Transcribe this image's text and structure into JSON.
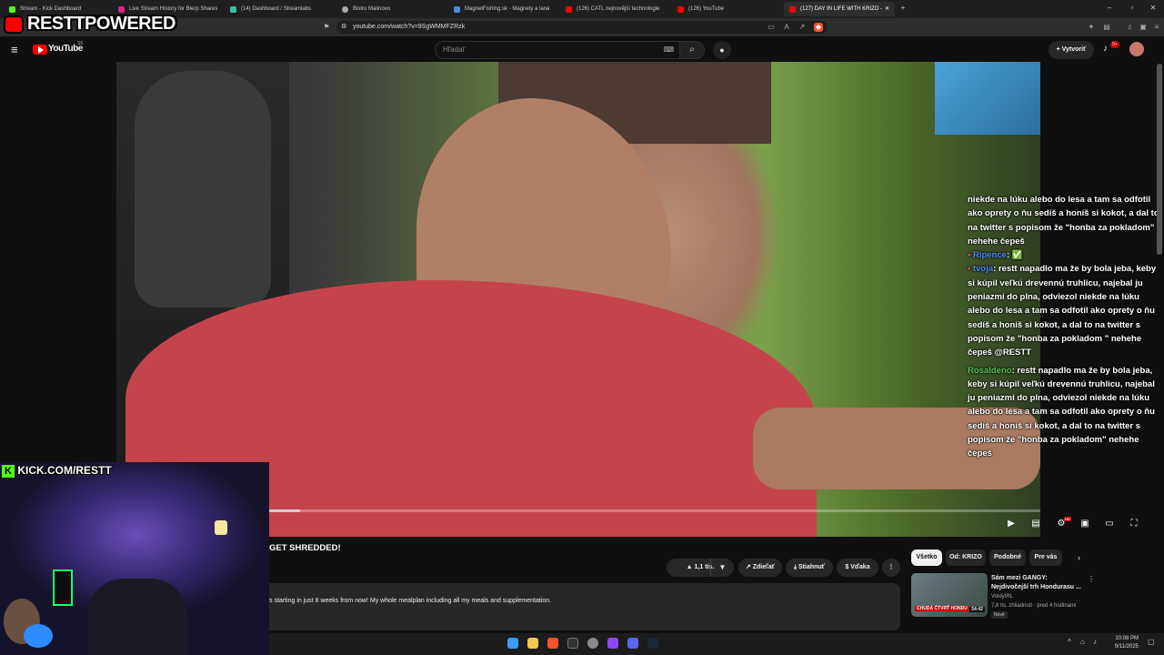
{
  "browser": {
    "tabs": [
      {
        "label": "Stream - Kick Dashboard",
        "color": "#53fc18"
      },
      {
        "label": "Live Stream History for Blerp Shares",
        "color": "#e0218a"
      },
      {
        "label": "(14) Dashboard / Streamlabs",
        "color": "#31c3a2"
      },
      {
        "label": "Bistro Malinovo",
        "color": "#aaaaaa"
      },
      {
        "label": "MagnetFishing.sk - Magnety a laná",
        "color": "#4a90d9"
      },
      {
        "label": "(126) CATL nejnovější technologie",
        "color": "#ff0000"
      },
      {
        "label": "(126) YouTube",
        "color": "#ff0000"
      },
      {
        "label": "(127) DAY IN LIFE WITH KRIZO -",
        "color": "#ff0000"
      }
    ],
    "url": "youtube.com/watch?v=9SgWMMFZRzk"
  },
  "youtube": {
    "logo_text": "YouTube",
    "country": "SK",
    "search_placeholder": "Hľadať",
    "create_label": "Vytvoriť",
    "notif_count": "9+",
    "video_title": "GET SHREDDED!",
    "like_label": "1,1 tis.",
    "share_label": "Zdieľať",
    "download_label": "Stiahnuť",
    "thanks_label": "Vďaka",
    "description": "s starting in just 8 weeks from now! My whole mealplan including all my meals and supplementation.",
    "progress": 0.04,
    "hd_badge": "HD",
    "chips": [
      "Všetko",
      "Od: KRIZO",
      "Podobné",
      "Pre vás"
    ],
    "recommendation": {
      "title": "Sám mezi GANGY: Nejdivočejší trh Hondurasu ...",
      "channel": "VoldyIRL",
      "meta": "7,8 tis. zhliadnutí · pred 4 hodinami",
      "badge": "Nové",
      "duration": "54:42",
      "thumb_text": "CHUDÁ ČTVRŤ HONDU"
    }
  },
  "chat": [
    {
      "user": "",
      "text": "niekde na lúku alebo do lesa a tam sa odfotil ako oprety o ňu sedíš a honíš si kokot, a dal to na twitter s popisom že \"honba za pokladom\" nehehe čepeš"
    },
    {
      "user": "Ripence",
      "user_color": "#4a8cff",
      "text": ": ✅"
    },
    {
      "user": "tvoja",
      "user_color": "#4a8cff",
      "text": ": restt napadlo ma že by bola jeba, keby si kúpil veľkú drevennú truhlicu, najebal ju peniazmi do plna, odviezol niekde na lúku alebo do lesa a tam sa odfotil ako oprety o ňu sedíš a honíš si kokot, a dal to na twitter s popisom že \"honba za pokladom \" nehehe čepeš @RESTT"
    },
    {
      "user": "Rosaldeno",
      "user_color": "#53c653",
      "text": ": restt napadlo ma že by bola jeba, keby si kúpil veľkú drevennú truhlicu, najebal ju peniazmi do plna, odviezol niekde na lúku alebo do lesa a tam sa odfotil ako oprety o ňu sedíš a honíš si kokot, a dal to na twitter s popisom že \"honba za pokladom\" nehehe čepeš"
    }
  ],
  "overlay": {
    "brand": "RESTTPOWERED",
    "kick_url": "KICK.COM/RESTT"
  },
  "taskbar": {
    "time": "10:08 PM",
    "date": "9/11/2025"
  },
  "icons": {
    "menu": "≡",
    "search": "⌕",
    "mic": "🎤",
    "bell": "🔔",
    "like": "👍",
    "dislike": "👎",
    "share": "↗",
    "download": "⤓",
    "more": "⋮",
    "play": "▶",
    "fullscreen": "⛶"
  }
}
